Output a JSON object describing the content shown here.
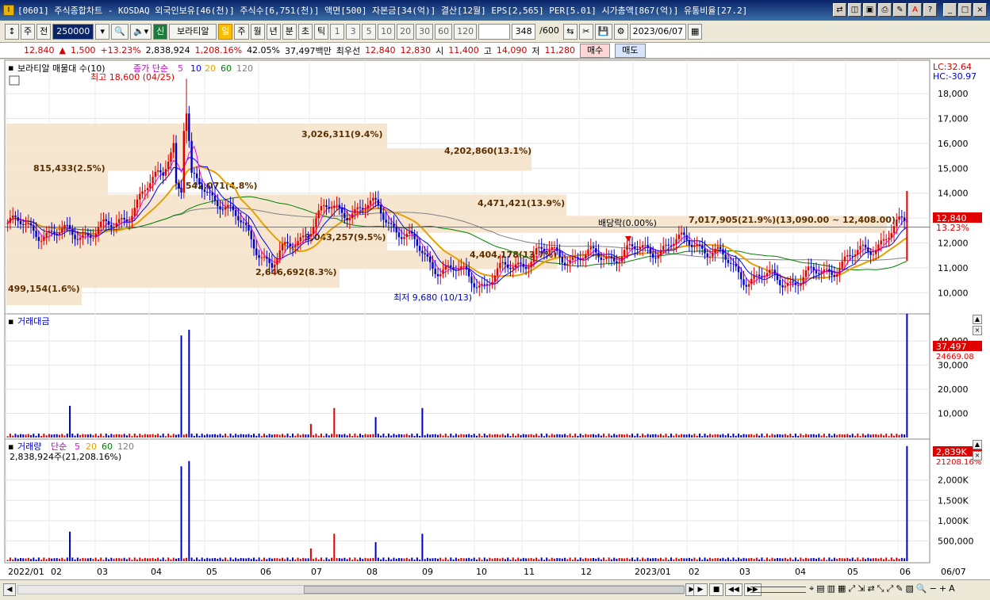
{
  "window": {
    "title": "[0601] 주식종합차트 - KOSDAQ 외국인보유[46(천)] 주식수[6,751(천)] 액면[500] 자본금[34(억)] 결산[12월] EPS[2,565] PER[5.01] 시가총액[867(억)] 유통비율[27.2]",
    "app_icon": "chart-app-icon"
  },
  "toolbar": {
    "period_select": "주",
    "period_toggle": "전",
    "code_input": "250000",
    "stock_type_badge": "신",
    "stock_name": "보라티알",
    "period_tabs": [
      "일",
      "주",
      "월",
      "년",
      "분",
      "초",
      "틱"
    ],
    "active_period": "일",
    "interval_buttons": [
      "1",
      "3",
      "5",
      "10",
      "20",
      "30",
      "60",
      "120"
    ],
    "count_value": "348",
    "count_total": "/600",
    "date_value": "2023/06/07"
  },
  "quote": {
    "price": "12,840",
    "change": "1,500",
    "change_pct": "+13.23%",
    "volume": "2,838,924",
    "volume_ratio": "1,208.16%",
    "turnover_pct": "42.05%",
    "amount": "37,497백만",
    "best_label": "최우선",
    "best_ask": "12,840",
    "best_bid": "12,830",
    "open_label": "시",
    "open": "11,400",
    "high_label": "고",
    "high": "14,090",
    "low_label": "저",
    "low": "11,280",
    "buy_button": "매수",
    "sell_button": "매도"
  },
  "panes": {
    "price": {
      "title": "보라티알 매물대 수(10)",
      "ma_label": "종가 단순",
      "ma_periods": [
        "5",
        "10",
        "20",
        "60",
        "120"
      ],
      "ma_colors": [
        "#ff00ff",
        "#0000ff",
        "#e6a000",
        "#008000",
        "#808080"
      ],
      "lc": "LC:32.64",
      "hc": "HC:-30.97",
      "current_price": "12,840",
      "current_pct": "13.23%",
      "y_ticks": [
        "18,000",
        "17,000",
        "16,000",
        "15,000",
        "14,000",
        "13,000",
        "12,000",
        "11,000",
        "10,000"
      ],
      "high_note": "최고 18,600 (04/25)",
      "low_note": "최저 9,680 (10/13)",
      "dividend_note": "배당락(0.00%)",
      "volume_profile": [
        "3,026,311(9.4%)",
        "4,202,860(13.1%)",
        "815,433(2.5%)",
        "1,542,071(4.8%)",
        "4,471,421(13.9%)",
        "7,017,905(21.9%)(13,090.00 ~ 12,408.00)",
        "3,043,257(9.5%)",
        "4,404,178(13.7%)",
        "2,646,692(8.3%)",
        "499,154(1.6%)"
      ]
    },
    "amount": {
      "title": "거래대금",
      "y_ticks": [
        "40,000",
        "30,000",
        "20,000",
        "10,000"
      ],
      "current": "37,497",
      "ma_value": "24669.08"
    },
    "volume": {
      "title": "거래량",
      "ma_label": "단순",
      "ma_periods": [
        "5",
        "20",
        "60",
        "120"
      ],
      "sub_label": "2,838,924주(21,208.16%)",
      "y_ticks": [
        "2,000K",
        "1,500K",
        "1,000K",
        "500,000"
      ],
      "current": "2,839K",
      "ratio": "21208.16%"
    }
  },
  "x_axis": [
    "2022/01",
    "02",
    "03",
    "04",
    "05",
    "06",
    "07",
    "08",
    "09",
    "10",
    "11",
    "12",
    "2023/01",
    "02",
    "03",
    "04",
    "05",
    "06",
    "06/07"
  ],
  "chart_data": {
    "type": "candlestick",
    "price_range": [
      9500,
      18800
    ],
    "monthly_close": [
      {
        "x": "2022/01",
        "y": 12800
      },
      {
        "x": "02",
        "y": 12300
      },
      {
        "x": "03",
        "y": 12600
      },
      {
        "x": "04",
        "y": 15000
      },
      {
        "x": "05",
        "y": 13800
      },
      {
        "x": "06",
        "y": 11100
      },
      {
        "x": "07",
        "y": 13300
      },
      {
        "x": "08",
        "y": 13400
      },
      {
        "x": "09",
        "y": 11200
      },
      {
        "x": "10",
        "y": 10400
      },
      {
        "x": "11",
        "y": 11600
      },
      {
        "x": "12",
        "y": 11400
      },
      {
        "x": "2023/01",
        "y": 11700
      },
      {
        "x": "02",
        "y": 12100
      },
      {
        "x": "03",
        "y": 10600
      },
      {
        "x": "04",
        "y": 10500
      },
      {
        "x": "05",
        "y": 11400
      },
      {
        "x": "06",
        "y": 12840
      }
    ],
    "volume_spikes": [
      {
        "x": "02",
        "y": 780000
      },
      {
        "x": "04",
        "y": 2500000
      },
      {
        "x": "04",
        "y": 2350000
      },
      {
        "x": "07",
        "y": 650000
      },
      {
        "x": "08",
        "y": 380000
      },
      {
        "x": "09",
        "y": 480000
      },
      {
        "x": "05",
        "y": 350000
      },
      {
        "x": "06/07",
        "y": 2838924
      }
    ]
  },
  "bottom_bar": {
    "nav_buttons": [
      "▶",
      "■",
      "◀◀",
      "▶▶"
    ],
    "zoom_minus": "−",
    "zoom_plus": "+",
    "a_button": "A"
  },
  "colors": {
    "up": "#e00000",
    "down": "#0000c8",
    "volume_profile": "#f6e6d0",
    "ma5": "#ff00ff",
    "ma10": "#0000ff",
    "ma20": "#e6a000",
    "ma60": "#008000",
    "ma120": "#808080"
  }
}
